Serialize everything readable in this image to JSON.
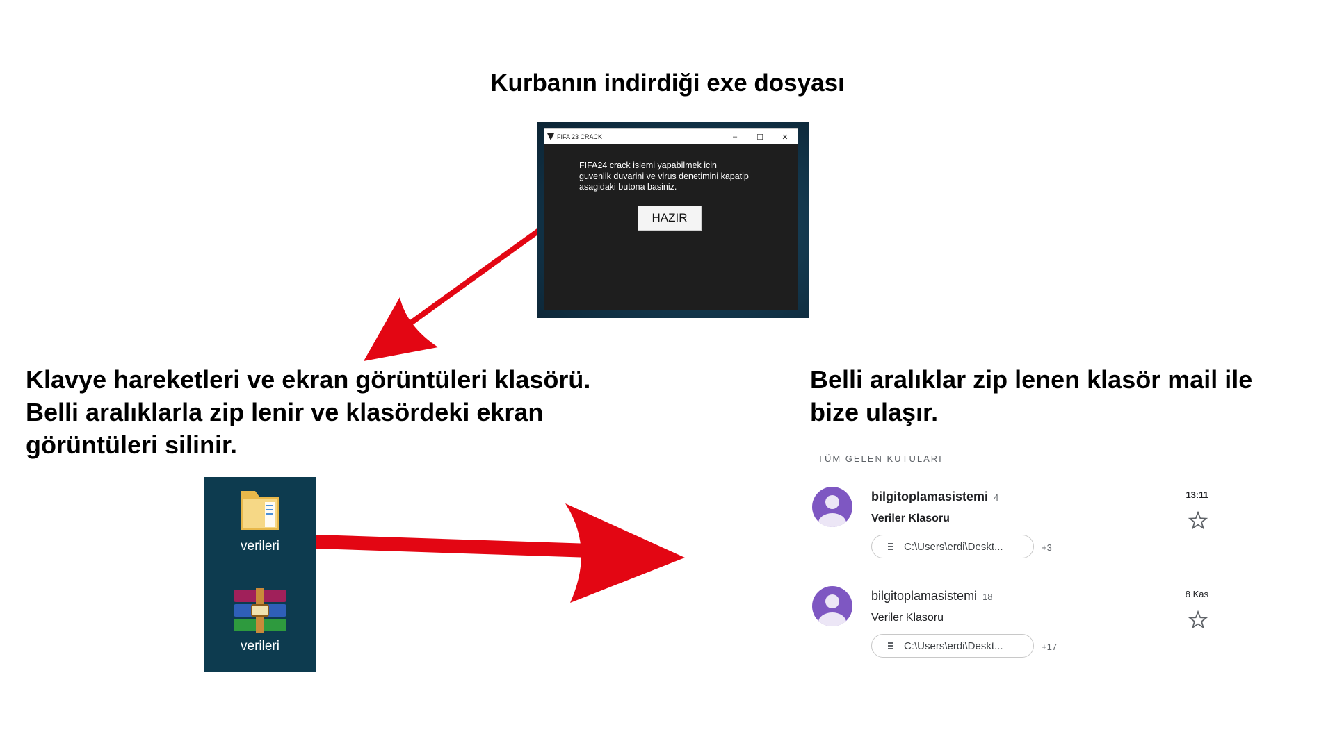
{
  "headings": {
    "top": "Kurbanın indirdiği exe dosyası",
    "left": [
      "Klavye hareketleri ve ekran görüntüleri klasörü.",
      "Belli aralıklarla zip lenir ve klasördeki ekran",
      "görüntüleri silinir."
    ],
    "right": [
      "Belli aralıklar zip lenen klasör mail ile",
      "bize ulaşır."
    ]
  },
  "exe_window": {
    "title": "FIFA 23 CRACK",
    "controls": {
      "minimize": "–",
      "maximize": "☐",
      "close": "✕"
    },
    "message": [
      "FIFA24 crack islemi yapabilmek icin",
      "guvenlik duvarini ve virus denetimini kapatip",
      "asagidaki butona basiniz."
    ],
    "button_label": "HAZIR"
  },
  "desktop": {
    "items": [
      {
        "label": "verileri",
        "icon": "folder-icon"
      },
      {
        "label": "verileri",
        "icon": "winrar-archive-icon"
      }
    ]
  },
  "mail": {
    "section_label": "TÜM GELEN KUTULARI",
    "messages": [
      {
        "sender": "bilgitoplamasistemi",
        "count": "4",
        "subject": "Veriler Klasoru",
        "time": "13:11",
        "attachment": "C:\\Users\\erdi\\Deskt...",
        "more": "+3",
        "unread": true
      },
      {
        "sender": "bilgitoplamasistemi",
        "count": "18",
        "subject": "Veriler Klasoru",
        "time": "8 Kas",
        "attachment": "C:\\Users\\erdi\\Deskt...",
        "more": "+17",
        "unread": false
      }
    ]
  },
  "colors": {
    "arrow": "#e30613",
    "avatar": "#7e57c2",
    "desktop_bg": "#0d3b4f",
    "exe_window_bg": "#1e1e1e"
  }
}
